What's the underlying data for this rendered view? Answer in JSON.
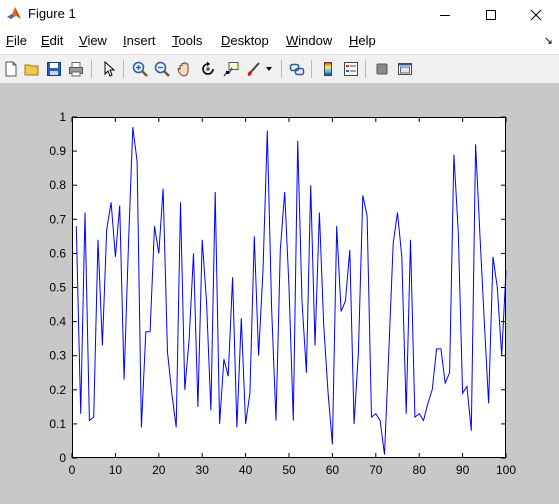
{
  "window": {
    "title": "Figure 1",
    "controls": [
      "minimize",
      "maximize",
      "close"
    ]
  },
  "menu": {
    "items": [
      {
        "label": "File",
        "accel": "F",
        "rest": "ile"
      },
      {
        "label": "Edit",
        "accel": "E",
        "rest": "dit"
      },
      {
        "label": "View",
        "accel": "V",
        "rest": "iew"
      },
      {
        "label": "Insert",
        "accel": "I",
        "rest": "nsert"
      },
      {
        "label": "Tools",
        "accel": "T",
        "rest": "ools"
      },
      {
        "label": "Desktop",
        "accel": "D",
        "rest": "esktop"
      },
      {
        "label": "Window",
        "accel": "W",
        "rest": "indow"
      },
      {
        "label": "Help",
        "accel": "H",
        "rest": "elp"
      }
    ],
    "overflow_arrow": "↘"
  },
  "toolbar": {
    "icons": [
      "new-figure-icon",
      "open-file-icon",
      "save-icon",
      "print-icon",
      "edit-plot-icon",
      "zoom-in-icon",
      "zoom-out-icon",
      "pan-icon",
      "rotate-3d-icon",
      "data-cursor-icon",
      "brush-icon",
      "link-plot-icon",
      "colorbar-icon",
      "legend-icon",
      "hide-plot-tools-icon",
      "show-plot-tools-icon"
    ]
  },
  "chart_data": {
    "type": "line",
    "title": "",
    "xlabel": "",
    "ylabel": "",
    "xlim": [
      0,
      100
    ],
    "ylim": [
      0,
      1
    ],
    "x_ticks": [
      "0",
      "10",
      "20",
      "30",
      "40",
      "50",
      "60",
      "70",
      "80",
      "90",
      "100"
    ],
    "y_ticks": [
      "0",
      "0.1",
      "0.2",
      "0.3",
      "0.4",
      "0.5",
      "0.6",
      "0.7",
      "0.8",
      "0.9",
      "1"
    ],
    "grid": false,
    "colors": {
      "line": "#0000ff",
      "axes_bg": "#ffffff",
      "figure_bg": "#c8c8c8"
    },
    "series": [
      {
        "x": [
          1,
          2,
          3,
          4,
          5,
          6,
          7,
          8,
          9,
          10,
          11,
          12,
          13,
          14,
          15,
          16,
          17,
          18,
          19,
          20,
          21,
          22,
          23,
          24,
          25,
          26,
          27,
          28,
          29,
          30,
          31,
          32,
          33,
          34,
          35,
          36,
          37,
          38,
          39,
          40,
          41,
          42,
          43,
          44,
          45,
          46,
          47,
          48,
          49,
          50,
          51,
          52,
          53,
          54,
          55,
          56,
          57,
          58,
          59,
          60,
          61,
          62,
          63,
          64,
          65,
          66,
          67,
          68,
          69,
          70,
          71,
          72,
          73,
          74,
          75,
          76,
          77,
          78,
          79,
          80,
          81,
          82,
          83,
          84,
          85,
          86,
          87,
          88,
          89,
          90,
          91,
          92,
          93,
          94,
          95,
          96,
          97,
          98,
          99,
          100
        ],
        "y": [
          0.68,
          0.13,
          0.72,
          0.11,
          0.12,
          0.64,
          0.33,
          0.67,
          0.75,
          0.59,
          0.74,
          0.23,
          0.62,
          0.97,
          0.87,
          0.09,
          0.37,
          0.37,
          0.68,
          0.6,
          0.79,
          0.31,
          0.19,
          0.09,
          0.75,
          0.2,
          0.35,
          0.6,
          0.15,
          0.64,
          0.46,
          0.14,
          0.78,
          0.1,
          0.29,
          0.24,
          0.53,
          0.09,
          0.41,
          0.1,
          0.19,
          0.65,
          0.3,
          0.55,
          0.96,
          0.44,
          0.11,
          0.61,
          0.78,
          0.5,
          0.11,
          0.93,
          0.46,
          0.25,
          0.8,
          0.33,
          0.72,
          0.39,
          0.19,
          0.04,
          0.68,
          0.43,
          0.46,
          0.61,
          0.1,
          0.31,
          0.77,
          0.71,
          0.12,
          0.13,
          0.11,
          0.01,
          0.31,
          0.63,
          0.72,
          0.59,
          0.13,
          0.64,
          0.12,
          0.13,
          0.11,
          0.16,
          0.2,
          0.32,
          0.32,
          0.22,
          0.25,
          0.89,
          0.66,
          0.19,
          0.21,
          0.08,
          0.92,
          0.65,
          0.4,
          0.16,
          0.59,
          0.5,
          0.3,
          0.55
        ]
      }
    ]
  }
}
